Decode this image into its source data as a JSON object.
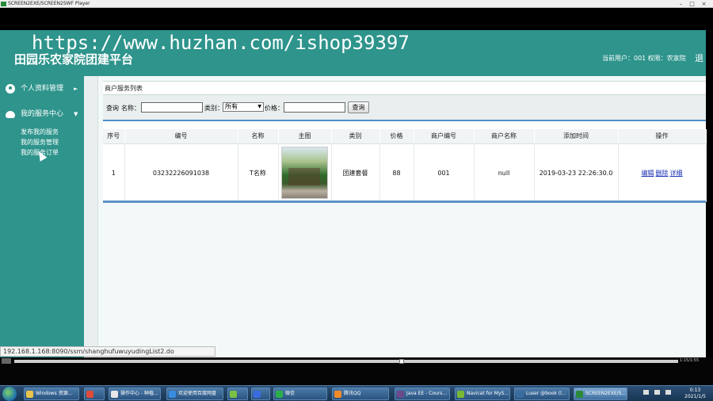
{
  "player": {
    "title": "SCREEN2EXE/SCREEN2SWF Player",
    "time": "1:15/1:55"
  },
  "header": {
    "watermark": "https://www.huzhan.com/ishop39397",
    "title": "田园乐农家院团建平台",
    "user_info": "当前用户：001 权限：农家院",
    "logout": "退"
  },
  "sidebar": {
    "groups": [
      {
        "label": "个人资料管理",
        "arrow": "►",
        "icon": "person-icon"
      },
      {
        "label": "我的服务中心",
        "arrow": "▼",
        "icon": "cloud-icon"
      }
    ],
    "submenu": [
      "发布我的服务",
      "我的服务管理",
      "我的服务订单"
    ]
  },
  "panel": {
    "title": "商户服务列表"
  },
  "search": {
    "query_label": "查询",
    "name_label": "名称：",
    "category_label": "类别：",
    "category_value": "所有",
    "price_label": "价格：",
    "button": "查询"
  },
  "table": {
    "columns": [
      "序号",
      "编号",
      "名称",
      "主图",
      "类别",
      "价格",
      "商户编号",
      "商户名称",
      "添加时间",
      "操作"
    ],
    "rows": [
      {
        "index": "1",
        "code": "03232226091038",
        "name": "T名称",
        "category": "团建套餐",
        "price": "88",
        "merchant_code": "001",
        "merchant_name": "null",
        "added_time": "2019-03-23 22:26:30.0",
        "actions": [
          "编辑",
          "删除",
          "详细"
        ]
      }
    ]
  },
  "statusbar": {
    "url": "192.168.1.168:8090/ssm/shanghufuwuyudingList2.do"
  },
  "taskbar": {
    "tasks": [
      {
        "label": "Windows 资源...",
        "color": "#e8c44a"
      },
      {
        "label": "",
        "color": "#e04a3a"
      },
      {
        "label": "操作中心 - 种植...",
        "color": "#e8e8e8"
      },
      {
        "label": "欢迎使用百度网盘",
        "color": "#3a8ce0"
      },
      {
        "label": "",
        "color": "#7bc043"
      },
      {
        "label": "",
        "color": "#3a6ce0"
      },
      {
        "label": "微信",
        "color": "#2aae47"
      },
      {
        "label": "腾讯QQ",
        "color": "#f08b2a"
      },
      {
        "label": "Java EE - Cours...",
        "color": "#6b4a8c"
      },
      {
        "label": "Navicat for MyS...",
        "color": "#7ab833"
      },
      {
        "label": "Luser @book (l...",
        "color": "#3a6ca0"
      },
      {
        "label": "SCREEN2EXE/S...",
        "color": "#2a8a3a"
      }
    ],
    "clock_time": "0:13",
    "clock_date": "2021/1/5"
  }
}
